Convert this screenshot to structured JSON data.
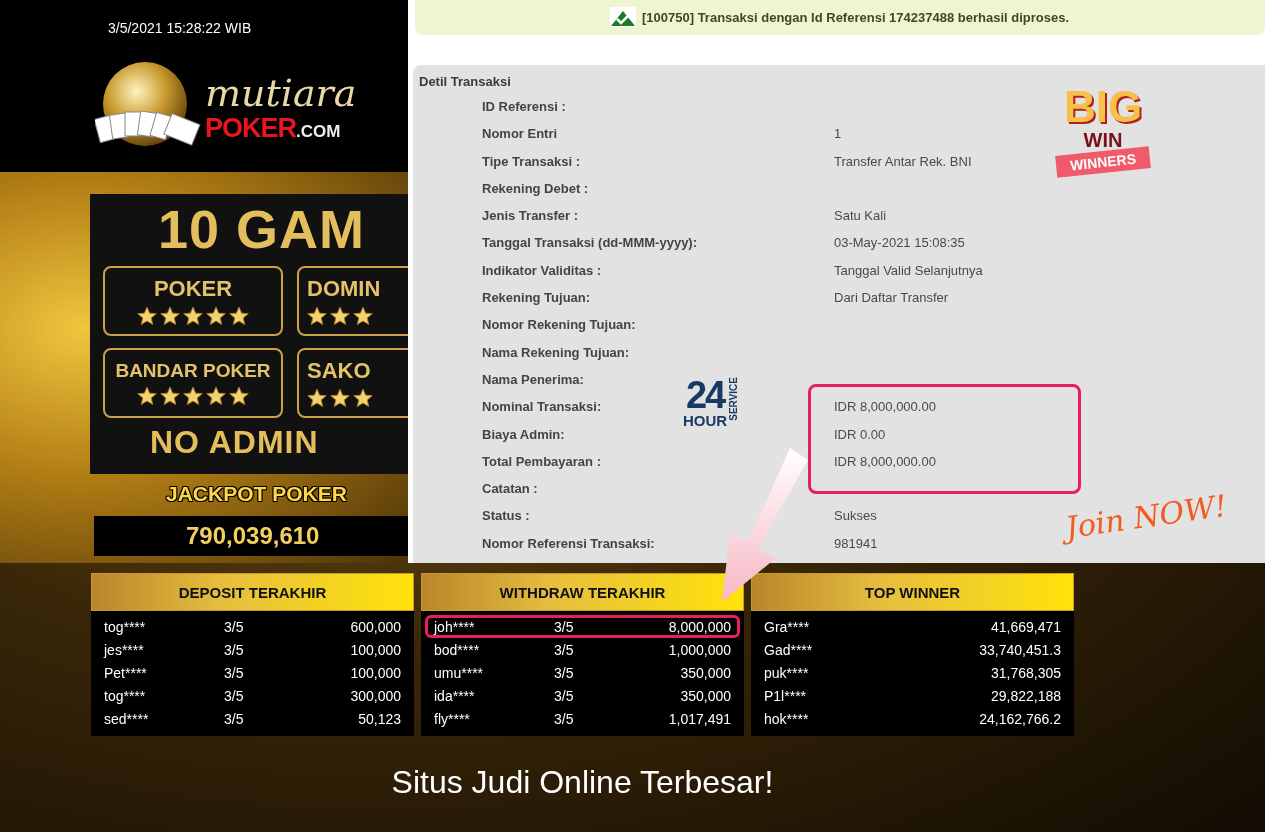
{
  "header": {
    "datetime": "3/5/2021 15:28:22 WIB",
    "logo": {
      "script": "mutiara",
      "brand": "POKER",
      "suffix": ".COM"
    }
  },
  "banner": {
    "heading": "10 GAM",
    "cards": [
      {
        "title": "POKER",
        "stars": 5
      },
      {
        "title": "DOMIN",
        "stars": 3
      },
      {
        "title": "BANDAR POKER",
        "stars": 5
      },
      {
        "title": "SAKO",
        "stars": 3
      }
    ],
    "footer": "NO ADMIN"
  },
  "jackpot": {
    "label": "JACKPOT POKER",
    "value": "790,039,610"
  },
  "notification": {
    "message": "[100750] Transaksi dengan Id Referensi 174237488 berhasil diproses."
  },
  "detail": {
    "title": "Detil Transaksi",
    "rows": [
      {
        "label": "ID Referensi :",
        "highlighted": false
      },
      {
        "label": "Nomor Entri",
        "value": "1",
        "highlighted": false
      },
      {
        "label": "Tipe Transaksi :",
        "value": "Transfer Antar Rek. BNI",
        "highlighted": false
      },
      {
        "label": "Rekening Debet :",
        "highlighted": false
      },
      {
        "label": "Jenis Transfer :",
        "value": "Satu Kali",
        "highlighted": false
      },
      {
        "label": "Tanggal Transaksi (dd-MMM-yyyy):",
        "value": "03-May-2021 15:08:35",
        "highlighted": false
      },
      {
        "label": "Indikator Validitas :",
        "value": "Tanggal Valid Selanjutnya",
        "highlighted": false
      },
      {
        "label": "Rekening Tujuan:",
        "value": "Dari Daftar Transfer",
        "highlighted": false
      },
      {
        "label": "Nomor Rekening Tujuan:",
        "highlighted": false
      },
      {
        "label": "Nama Rekening Tujuan:",
        "highlighted": false
      },
      {
        "label": "Nama Penerima:",
        "highlighted": false
      },
      {
        "label": "Nominal Transaksi:",
        "value": "IDR 8,000,000.00",
        "highlighted": true
      },
      {
        "label": "Biaya Admin:",
        "value": "IDR 0.00",
        "highlighted": true
      },
      {
        "label": "Total Pembayaran :",
        "value": "IDR 8,000,000.00",
        "highlighted": true
      },
      {
        "label": "Catatan :",
        "highlighted": false
      },
      {
        "label": "Status :",
        "value": "Sukses",
        "highlighted": false
      },
      {
        "label": "Nomor Referensi Transaksi:",
        "value": "981941",
        "highlighted": false
      }
    ]
  },
  "badges": {
    "big_win": {
      "big": "BIG",
      "win": "WIN",
      "ribbon": "WINNERS"
    },
    "service": {
      "number": "24",
      "unit": "HOUR",
      "word": "SERVICE"
    },
    "join": "Join NOW!"
  },
  "tables": [
    {
      "title": "DEPOSIT TERAKHIR",
      "rows": [
        {
          "user": "tog****",
          "date": "3/5",
          "amount": "600,000",
          "highlighted": false
        },
        {
          "user": "jes****",
          "date": "3/5",
          "amount": "100,000",
          "highlighted": false
        },
        {
          "user": "Pet****",
          "date": "3/5",
          "amount": "100,000",
          "highlighted": false
        },
        {
          "user": "tog****",
          "date": "3/5",
          "amount": "300,000",
          "highlighted": false
        },
        {
          "user": "sed****",
          "date": "3/5",
          "amount": "50,123",
          "highlighted": false
        }
      ]
    },
    {
      "title": "WITHDRAW TERAKHIR",
      "rows": [
        {
          "user": "joh****",
          "date": "3/5",
          "amount": "8,000,000",
          "highlighted": true
        },
        {
          "user": "bod****",
          "date": "3/5",
          "amount": "1,000,000",
          "highlighted": false
        },
        {
          "user": "umu****",
          "date": "3/5",
          "amount": "350,000",
          "highlighted": false
        },
        {
          "user": "ida****",
          "date": "3/5",
          "amount": "350,000",
          "highlighted": false
        },
        {
          "user": "fly****",
          "date": "3/5",
          "amount": "1,017,491",
          "highlighted": false
        }
      ]
    },
    {
      "title": "TOP WINNER",
      "rows": [
        {
          "user": "Gra****",
          "amount": "41,669,471",
          "highlighted": false
        },
        {
          "user": "Gad****",
          "amount": "33,740,451.3",
          "highlighted": false
        },
        {
          "user": "puk****",
          "amount": "31,768,305",
          "highlighted": false
        },
        {
          "user": "P1l****",
          "amount": "29,822,188",
          "highlighted": false
        },
        {
          "user": "hok****",
          "amount": "24,162,766.2",
          "highlighted": false
        }
      ]
    }
  ],
  "tagline": "Situs Judi Online Terbesar!"
}
